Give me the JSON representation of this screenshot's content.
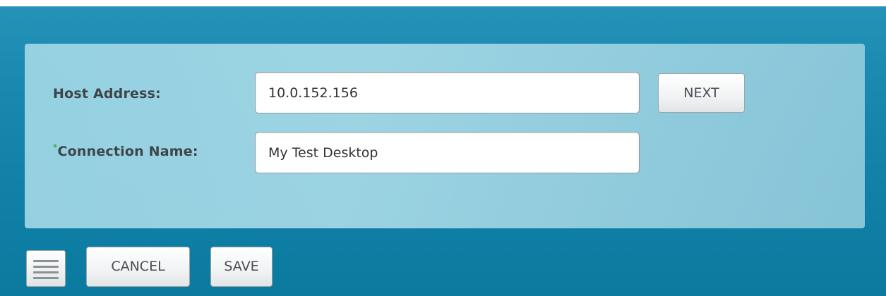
{
  "form": {
    "host_address": {
      "label": "Host Address:",
      "value": "10.0.152.156",
      "next_label": "NEXT"
    },
    "connection_name": {
      "required_marker": "*",
      "label": "Connection Name:",
      "value": "My Test Desktop"
    }
  },
  "footer": {
    "menu_icon": "hamburger-menu-icon",
    "cancel_label": "CANCEL",
    "save_label": "SAVE"
  },
  "colors": {
    "background": "#1a89b0",
    "panel": "#a6d8e6",
    "required_marker": "#4caf3c",
    "label_text": "#3e4448"
  }
}
